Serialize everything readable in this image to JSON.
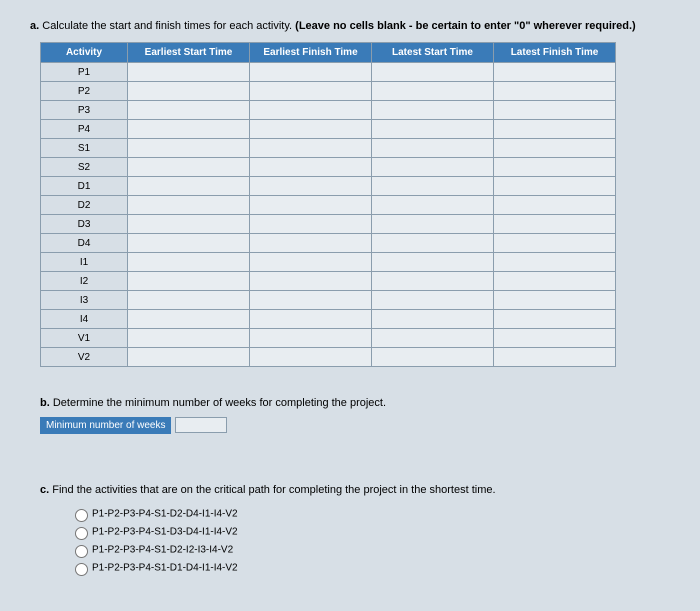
{
  "partA": {
    "prefix": "a.",
    "text": "Calculate the start and finish times for each activity.",
    "note": "(Leave no cells blank - be certain to enter \"0\" wherever required.)"
  },
  "table": {
    "headers": [
      "Activity",
      "Earliest Start Time",
      "Earliest Finish Time",
      "Latest Start Time",
      "Latest Finish Time"
    ],
    "activities": [
      "P1",
      "P2",
      "P3",
      "P4",
      "S1",
      "S2",
      "D1",
      "D2",
      "D3",
      "D4",
      "I1",
      "I2",
      "I3",
      "I4",
      "V1",
      "V2"
    ]
  },
  "partB": {
    "prefix": "b.",
    "text": "Determine the minimum number of weeks for completing the project.",
    "label": "Minimum number of weeks"
  },
  "partC": {
    "prefix": "c.",
    "text": "Find the activities that are on the critical path for completing the project in the shortest time.",
    "options": [
      "P1-P2-P3-P4-S1-D2-D4-I1-I4-V2",
      "P1-P2-P3-P4-S1-D3-D4-I1-I4-V2",
      "P1-P2-P3-P4-S1-D2-I2-I3-I4-V2",
      "P1-P2-P3-P4-S1-D1-D4-I1-I4-V2"
    ]
  }
}
